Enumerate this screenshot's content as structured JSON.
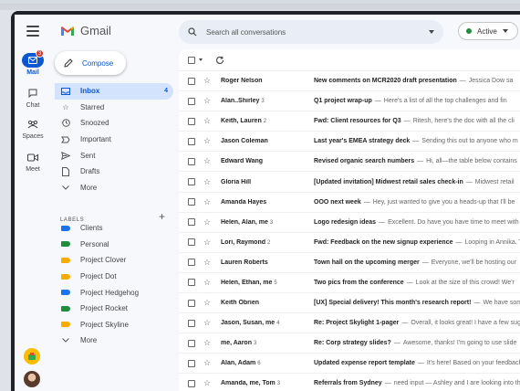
{
  "app": {
    "logo_text": "Gmail"
  },
  "rail": {
    "items": [
      {
        "label": "Mail",
        "badge": "3"
      },
      {
        "label": "Chat"
      },
      {
        "label": "Spaces"
      },
      {
        "label": "Meet"
      }
    ]
  },
  "compose": {
    "label": "Compose"
  },
  "nav": {
    "items": [
      {
        "label": "Inbox",
        "count": "4",
        "icon": "inbox-icon"
      },
      {
        "label": "Starred",
        "icon": "star-icon"
      },
      {
        "label": "Snoozed",
        "icon": "clock-icon"
      },
      {
        "label": "Important",
        "icon": "label-important-icon"
      },
      {
        "label": "Sent",
        "icon": "send-icon"
      },
      {
        "label": "Drafts",
        "icon": "draft-icon"
      },
      {
        "label": "More",
        "icon": "chevron-down-icon"
      }
    ]
  },
  "labels": {
    "header": "LABELS",
    "items": [
      {
        "label": "Clients",
        "color": "#1a73e8"
      },
      {
        "label": "Personal",
        "color": "#1e8e3e"
      },
      {
        "label": "Project Clover",
        "color": "#f9ab00"
      },
      {
        "label": "Project Dot",
        "color": "#f9ab00"
      },
      {
        "label": "Project Hedgehog",
        "color": "#1a73e8"
      },
      {
        "label": "Project Rocket",
        "color": "#1e8e3e"
      },
      {
        "label": "Project Skyline",
        "color": "#f9ab00"
      },
      {
        "label": "More",
        "color": ""
      }
    ]
  },
  "search": {
    "placeholder": "Search all conversations"
  },
  "status": {
    "label": "Active",
    "color": "#1e8e3e"
  },
  "emails": [
    {
      "sender": "Roger Nelson",
      "count": "",
      "subject": "New comments on MCR2020 draft presentation",
      "snippet": "Jessica Dow sa"
    },
    {
      "sender": "Alan..Shirley",
      "count": "3",
      "subject": "Q1 project wrap-up",
      "snippet": "Here's a list of all the top challenges and fin"
    },
    {
      "sender": "Keith, Lauren",
      "count": "2",
      "subject": "Fwd: Client resources for Q3",
      "snippet": "Ritesh, here's the doc with all the cli"
    },
    {
      "sender": "Jason Coleman",
      "count": "",
      "subject": "Last year's EMEA strategy deck",
      "snippet": "Sending this out to anyone who m"
    },
    {
      "sender": "Edward Wang",
      "count": "",
      "subject": "Revised organic search numbers",
      "snippet": "Hi, all—the table below contains"
    },
    {
      "sender": "Gloria Hill",
      "count": "",
      "subject": "[Updated invitation] Midwest retail sales check-in",
      "snippet": "Midwest retail"
    },
    {
      "sender": "Amanda Hayes",
      "count": "",
      "subject": "OOO next week",
      "snippet": "Hey, just wanted to give you a heads-up that I'll be"
    },
    {
      "sender": "Helen, Alan, me",
      "count": "3",
      "subject": "Logo redesign ideas",
      "snippet": "Excellent. Do have you have time to meet with"
    },
    {
      "sender": "Lori, Raymond",
      "count": "2",
      "subject": "Fwd: Feedback on the new signup experience",
      "snippet": "Looping in Annika. T"
    },
    {
      "sender": "Lauren Roberts",
      "count": "",
      "subject": "Town hall on the upcoming merger",
      "snippet": "Everyone, we'll be hosting our"
    },
    {
      "sender": "Helen, Ethan, me",
      "count": "5",
      "subject": "Two pics from the conference",
      "snippet": "Look at the size of this crowd! We'r"
    },
    {
      "sender": "Keith Obrien",
      "count": "",
      "subject": "[UX] Special delivery! This month's research report!",
      "snippet": "We have som"
    },
    {
      "sender": "Jason, Susan, me",
      "count": "4",
      "subject": "Re: Project Skylight 1-pager",
      "snippet": "Overall, it looks great! I have a few sug"
    },
    {
      "sender": "me, Aaron",
      "count": "3",
      "subject": "Re: Corp strategy slides?",
      "snippet": "Awesome, thanks! I'm going to use slide"
    },
    {
      "sender": "Alan, Adam",
      "count": "6",
      "subject": "Updated expense report template",
      "snippet": "It's here! Based on your feedback"
    },
    {
      "sender": "Amanda, me, Tom",
      "count": "3",
      "subject": "Referrals from Sydney",
      "snippet": "need input — Ashley and I are looking into th"
    }
  ]
}
